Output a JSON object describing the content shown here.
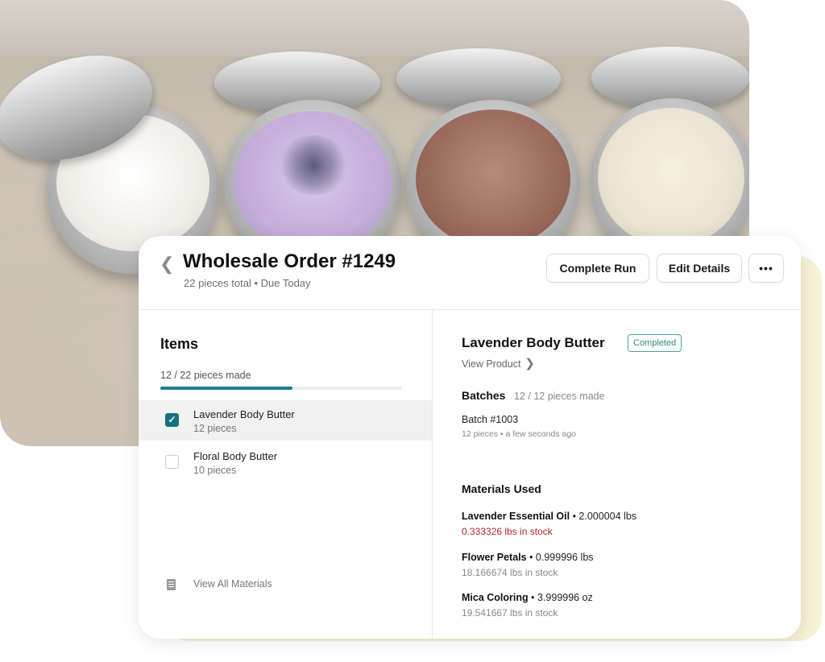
{
  "header": {
    "title": "Wholesale Order #1249",
    "subtitle": "22 pieces total • Due Today",
    "buttons": {
      "complete_run": "Complete Run",
      "edit_details": "Edit Details",
      "more": "•••"
    }
  },
  "items_panel": {
    "heading": "Items",
    "progress_text": "12 / 22 pieces made",
    "progress_fraction": 0.545,
    "items": [
      {
        "name": "Lavender Body Butter",
        "count": "12 pieces",
        "checked": true
      },
      {
        "name": "Floral Body Butter",
        "count": "10 pieces",
        "checked": false
      }
    ],
    "view_all_materials": "View All Materials"
  },
  "detail": {
    "product_title": "Lavender Body Butter",
    "status_badge": "Completed",
    "view_product": "View Product",
    "batches_heading": "Batches",
    "batches_sub": "12 / 12 pieces made",
    "batch": {
      "name": "Batch #1003",
      "meta": "12 pieces • a few seconds ago"
    },
    "materials_heading": "Materials Used",
    "materials": [
      {
        "name": "Lavender Essential Oil",
        "amount": "• 2.000004 lbs",
        "stock": "0.333326 lbs in stock",
        "low": true
      },
      {
        "name": "Flower Petals",
        "amount": "• 0.999996 lbs",
        "stock": "18.166674 lbs in stock",
        "low": false
      },
      {
        "name": "Mica Coloring",
        "amount": "• 3.999996 oz",
        "stock": "19.541667 lbs in stock",
        "low": false
      }
    ]
  },
  "colors": {
    "accent": "#14727e",
    "badge_border": "#4aa29e",
    "low_stock": "#b3262d",
    "card_yellow": "#f8f1d8"
  },
  "icons": {
    "back": "chevron-left-icon",
    "check": "check-icon",
    "materials": "document-icon",
    "view_product": "chevron-right-icon"
  }
}
